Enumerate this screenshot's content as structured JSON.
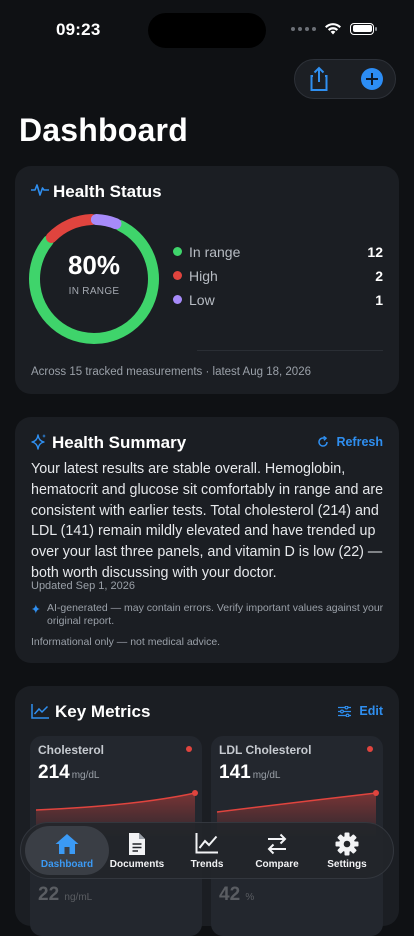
{
  "status_bar": {
    "time": "09:23"
  },
  "header": {
    "title": "Dashboard"
  },
  "health_status": {
    "title": "Health Status",
    "percent_label": "80%",
    "percent_caption": "IN RANGE",
    "percent": 80,
    "legend": [
      {
        "label": "In range",
        "count": "12",
        "color": "#3fd46b"
      },
      {
        "label": "High",
        "count": "2",
        "color": "#e0443e"
      },
      {
        "label": "Low",
        "count": "1",
        "color": "#a78bfa"
      }
    ],
    "footer": "Across 15 tracked measurements · latest Aug 18, 2026"
  },
  "health_summary": {
    "title": "Health Summary",
    "refresh_label": "Refresh",
    "body": "Your latest results are stable overall. Hemoglobin, hematocrit and glucose sit comfortably in range and are consistent with earlier tests. Total cholesterol (214) and LDL (141) remain mildly elevated and have trended up over your last three panels, and vitamin D is low (22) — both worth discussing with your doctor.",
    "updated": "Updated Sep 1, 2026",
    "ai_note": "AI-generated — may contain errors. Verify important values against your original report.",
    "disclaimer": "Informational only — not medical advice."
  },
  "key_metrics": {
    "title": "Key Metrics",
    "edit_label": "Edit",
    "tiles": [
      {
        "name": "Cholesterol",
        "value": "214",
        "unit": "mg/dL",
        "status_color": "#e0443e"
      },
      {
        "name": "LDL Cholesterol",
        "value": "141",
        "unit": "mg/dL",
        "status_color": "#e0443e"
      }
    ],
    "partial_tiles": [
      {
        "value": "22",
        "unit": "ng/mL"
      },
      {
        "value": "42",
        "unit": "%"
      }
    ]
  },
  "tab_bar": {
    "tabs": [
      {
        "label": "Dashboard",
        "icon": "home-icon",
        "active": true
      },
      {
        "label": "Documents",
        "icon": "document-icon",
        "active": false
      },
      {
        "label": "Trends",
        "icon": "trend-icon",
        "active": false
      },
      {
        "label": "Compare",
        "icon": "compare-arrows-icon",
        "active": false
      },
      {
        "label": "Settings",
        "icon": "gear-icon",
        "active": false
      }
    ]
  },
  "colors": {
    "accent": "#2f8ff0",
    "in_range": "#3fd46b",
    "high": "#e0443e",
    "low": "#a78bfa"
  }
}
